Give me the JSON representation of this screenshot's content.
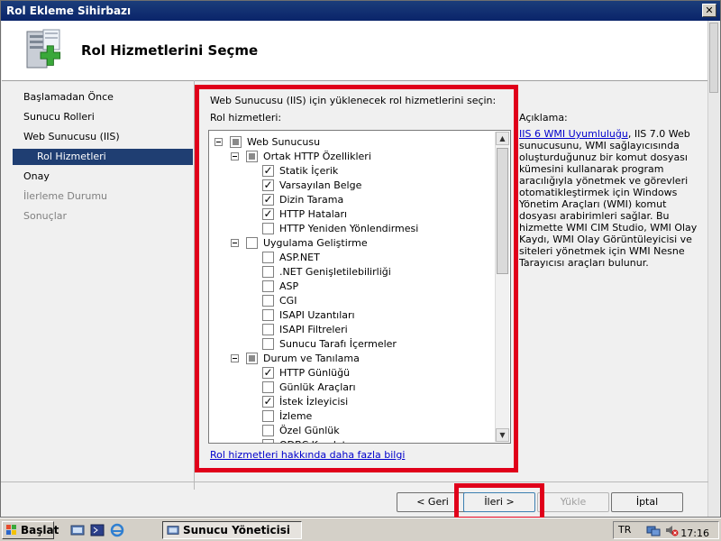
{
  "window": {
    "title": "Rol Ekleme Sihirbazı",
    "close_glyph": "✕"
  },
  "header": {
    "title": "Rol Hizmetlerini Seçme",
    "icon": "server-add-icon"
  },
  "nav": {
    "items": [
      {
        "label": "Başlamadan Önce",
        "state": "normal"
      },
      {
        "label": "Sunucu Rolleri",
        "state": "normal"
      },
      {
        "label": "Web Sunucusu (IIS)",
        "state": "normal"
      },
      {
        "label": "Rol Hizmetleri",
        "state": "selected"
      },
      {
        "label": "Onay",
        "state": "normal"
      },
      {
        "label": "İlerleme Durumu",
        "state": "disabled"
      },
      {
        "label": "Sonuçlar",
        "state": "disabled"
      }
    ]
  },
  "main": {
    "instruction": "Web Sunucusu (IIS) için yüklenecek rol hizmetlerini seçin:",
    "list_label": "Rol hizmetleri:",
    "more_link": "Rol hizmetleri hakkında daha fazla bilgi"
  },
  "tree": [
    {
      "label": "Web Sunucusu",
      "level": 0,
      "state": "partial",
      "expander": true
    },
    {
      "label": "Ortak HTTP Özellikleri",
      "level": 1,
      "state": "partial",
      "expander": true
    },
    {
      "label": "Statik İçerik",
      "level": 2,
      "state": "checked"
    },
    {
      "label": "Varsayılan Belge",
      "level": 2,
      "state": "checked"
    },
    {
      "label": "Dizin Tarama",
      "level": 2,
      "state": "checked"
    },
    {
      "label": "HTTP Hataları",
      "level": 2,
      "state": "checked"
    },
    {
      "label": "HTTP Yeniden Yönlendirmesi",
      "level": 2,
      "state": "unchecked"
    },
    {
      "label": "Uygulama Geliştirme",
      "level": 1,
      "state": "unchecked",
      "expander": true
    },
    {
      "label": "ASP.NET",
      "level": 2,
      "state": "unchecked"
    },
    {
      "label": ".NET Genişletilebilirliği",
      "level": 2,
      "state": "unchecked"
    },
    {
      "label": "ASP",
      "level": 2,
      "state": "unchecked"
    },
    {
      "label": "CGI",
      "level": 2,
      "state": "unchecked"
    },
    {
      "label": "ISAPI Uzantıları",
      "level": 2,
      "state": "unchecked"
    },
    {
      "label": "ISAPI Filtreleri",
      "level": 2,
      "state": "unchecked"
    },
    {
      "label": "Sunucu Tarafı İçermeler",
      "level": 2,
      "state": "unchecked"
    },
    {
      "label": "Durum ve Tanılama",
      "level": 1,
      "state": "partial",
      "expander": true
    },
    {
      "label": "HTTP Günlüğü",
      "level": 2,
      "state": "checked"
    },
    {
      "label": "Günlük Araçları",
      "level": 2,
      "state": "unchecked"
    },
    {
      "label": "İstek İzleyicisi",
      "level": 2,
      "state": "checked"
    },
    {
      "label": "İzleme",
      "level": 2,
      "state": "unchecked"
    },
    {
      "label": "Özel Günlük",
      "level": 2,
      "state": "unchecked"
    },
    {
      "label": "ODBC Kaydetme",
      "level": 2,
      "state": "unchecked"
    }
  ],
  "description": {
    "label": "Açıklama:",
    "link": "IIS 6 WMI Uyumluluğu",
    "text": ", IIS 7.0 Web sunucusunu, WMI sağlayıcısında oluşturduğunuz bir komut dosyası kümesini kullanarak program aracılığıyla yönetmek ve görevleri otomatikleştirmek için Windows Yönetim Araçları (WMI) komut dosyası arabirimleri sağlar. Bu hizmette WMI CIM Studio, WMI Olay Kaydı, WMI Olay Görüntüleyicisi ve siteleri yönetmek için WMI Nesne Tarayıcısı araçları bulunur."
  },
  "buttons": {
    "back": "< Geri",
    "next": "İleri >",
    "install": "Yükle",
    "cancel": "İptal"
  },
  "taskbar": {
    "start": "Başlat",
    "task": "Sunucu Yöneticisi",
    "lang": "TR",
    "clock": "17:16"
  },
  "colors": {
    "highlight": "#e0001a",
    "selection": "#1f3e72",
    "link": "#0000cc"
  }
}
